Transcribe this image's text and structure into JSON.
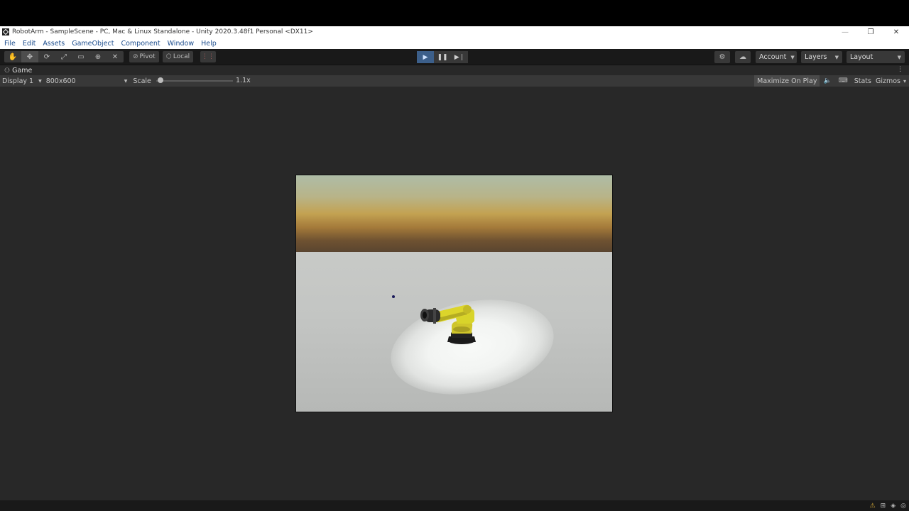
{
  "window": {
    "title": "RobotArm - SampleScene - PC, Mac & Linux Standalone - Unity 2020.3.48f1 Personal <DX11>",
    "controls": {
      "minimize": "—",
      "restore": "❐",
      "close": "✕"
    }
  },
  "menu": {
    "items": [
      "File",
      "Edit",
      "Assets",
      "GameObject",
      "Component",
      "Window",
      "Help"
    ]
  },
  "toolbar": {
    "tools": [
      {
        "name": "hand-tool-icon",
        "glyph": "✋",
        "active": false
      },
      {
        "name": "move-tool-icon",
        "glyph": "✥",
        "active": true
      },
      {
        "name": "rotate-tool-icon",
        "glyph": "⟳",
        "active": false
      },
      {
        "name": "scale-tool-icon",
        "glyph": "⤢",
        "active": false
      },
      {
        "name": "rect-tool-icon",
        "glyph": "▭",
        "active": false
      },
      {
        "name": "transform-tool-icon",
        "glyph": "⊕",
        "active": false
      },
      {
        "name": "custom-tool-icon",
        "glyph": "✕",
        "active": false
      }
    ],
    "pivot_label": "Pivot",
    "local_label": "Local",
    "grid_snap_glyph": "⋮⋮",
    "play_glyph": "▶",
    "pause_glyph": "❚❚",
    "step_glyph": "▶❘",
    "services_glyph": "⚙",
    "cloud_glyph": "☁",
    "account_label": "Account",
    "layers_label": "Layers",
    "layout_label": "Layout"
  },
  "game_tab": {
    "icon_glyph": "⚇",
    "label": "Game",
    "kebab_glyph": "⋮"
  },
  "game_bar": {
    "display": "Display 1",
    "resolution": "800x600",
    "scale_label": "Scale",
    "scale_value": "1.1x",
    "scale_fraction": 0.02,
    "maximize_label": "Maximize On Play",
    "mute_glyph": "🔈",
    "keyboard_glyph": "⌨",
    "stats_label": "Stats",
    "gizmos_label": "Gizmos",
    "gizmos_caret": "▾"
  },
  "status": {
    "icons": [
      "⚠",
      "⊞",
      "◈",
      "◎"
    ]
  },
  "colors": {
    "editor_bg": "#282828",
    "toolbar_bg": "#191919",
    "accent_play": "#3c5f8a",
    "robot_yellow": "#d8d42a"
  }
}
